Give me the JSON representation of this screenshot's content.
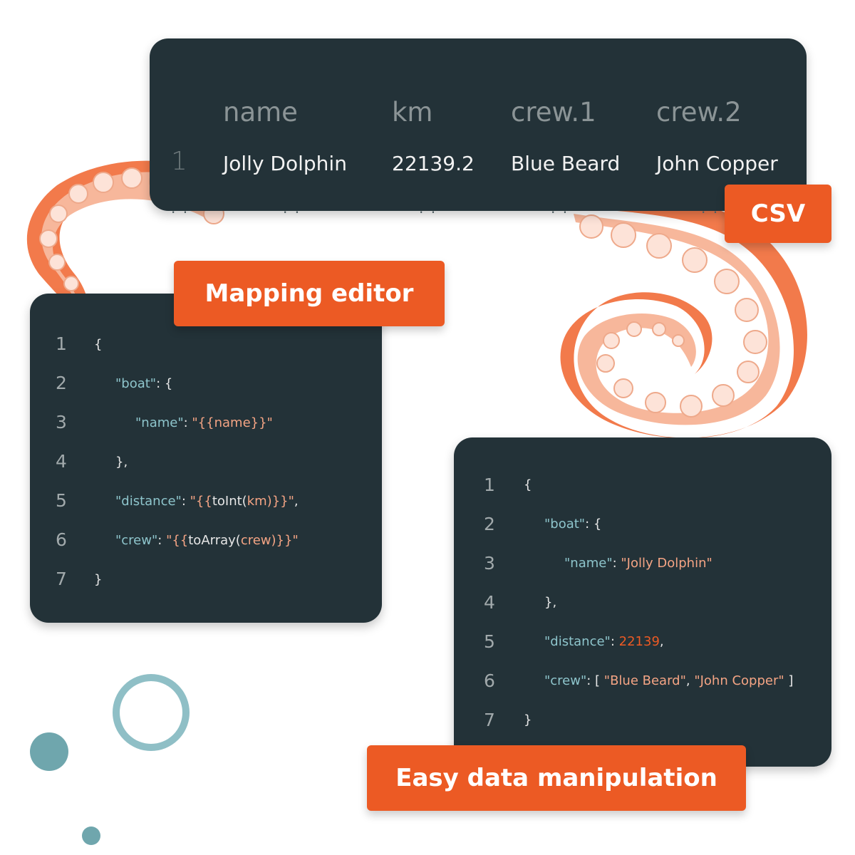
{
  "csv": {
    "headers": [
      "name",
      "km",
      "crew.1",
      "crew.2"
    ],
    "row_index": "1",
    "row": [
      "Jolly Dolphin",
      "22139.2",
      "Blue Beard",
      "John Copper"
    ],
    "ellipsis": ". .",
    "tag": "CSV"
  },
  "mapping": {
    "tag": "Mapping editor",
    "line_numbers": [
      "1",
      "2",
      "3",
      "4",
      "5",
      "6",
      "7"
    ],
    "lines": {
      "l1_open": "{",
      "l2_key": "\"boat\"",
      "l2_rest": ": {",
      "l3_key": "\"name\"",
      "l3_sep": ": ",
      "l3_val_open": "\"{{",
      "l3_val_field": "name",
      "l3_val_close": "}}\"",
      "l4_close": "},",
      "l5_key": "\"distance\"",
      "l5_sep": ": ",
      "l5_val_open": "\"{{",
      "l5_func": "toInt(",
      "l5_field": "km",
      "l5_val_close": ")}}\"",
      "l5_comma": ",",
      "l6_key": "\"crew\"",
      "l6_sep": ": ",
      "l6_val_open": "\"{{",
      "l6_func": "toArray(",
      "l6_field": "crew",
      "l6_val_close": ")}}\"",
      "l7_close": "}"
    }
  },
  "result": {
    "tag": "Easy data manipulation",
    "line_numbers": [
      "1",
      "2",
      "3",
      "4",
      "5",
      "6",
      "7"
    ],
    "lines": {
      "l1_open": "{",
      "l2_key": "\"boat\"",
      "l2_rest": ": {",
      "l3_key": "\"name\"",
      "l3_sep": ": ",
      "l3_val": "\"Jolly Dolphin\"",
      "l4_close": "},",
      "l5_key": "\"distance\"",
      "l5_sep": ": ",
      "l5_val": "22139",
      "l5_comma": ",",
      "l6_key": "\"crew\"",
      "l6_sep": ": [ ",
      "l6_v1": "\"Blue Beard\"",
      "l6_comma": ", ",
      "l6_v2": "\"John Copper\"",
      "l6_end": " ]",
      "l7_close": "}"
    }
  },
  "colors": {
    "panel": "#233238",
    "accent": "#ec5a24",
    "tentacle": "#f27a4b",
    "suckers": "#f9d3c4",
    "key_text": "#8ec5cc",
    "string_text": "#f4a484",
    "circles": "#6fa6ad"
  },
  "decor_icons": [
    "tentacle-left",
    "tentacle-right",
    "ring-circle",
    "dot-large",
    "dot-small"
  ]
}
